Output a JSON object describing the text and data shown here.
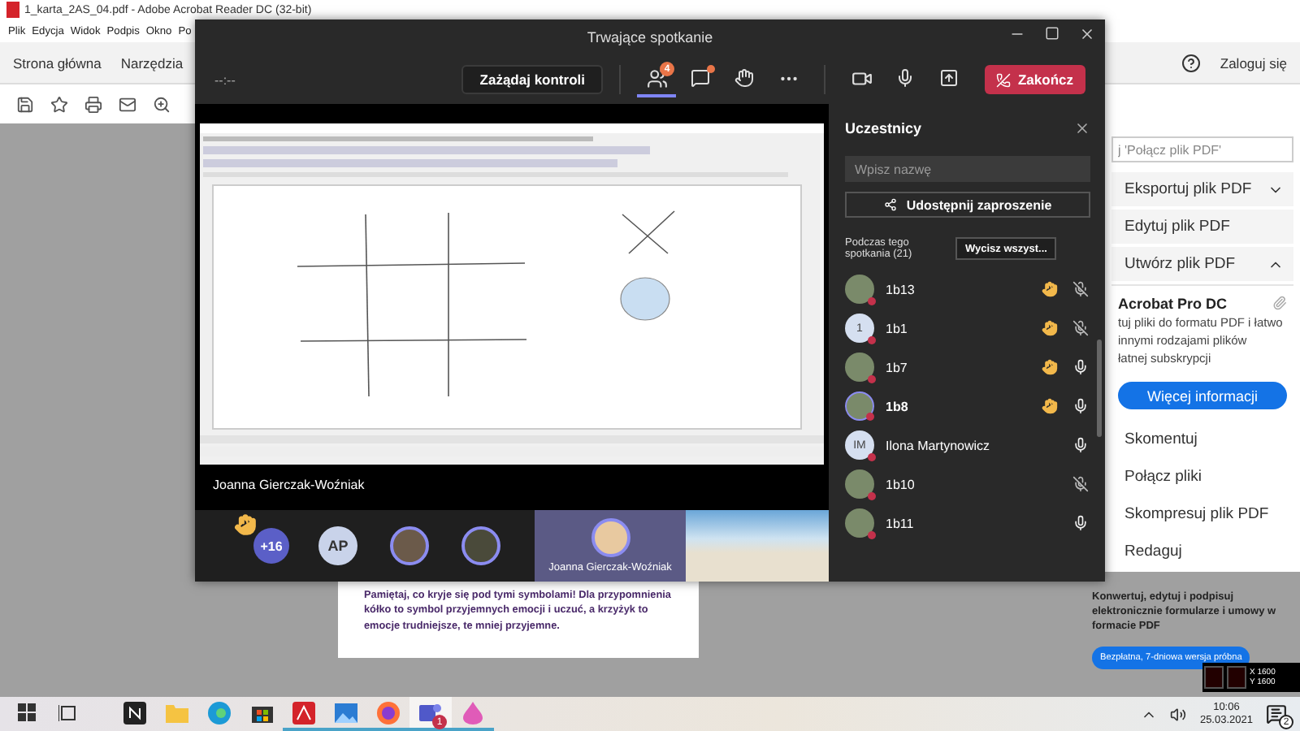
{
  "acrobat": {
    "title": "1_karta_2AS_04.pdf - Adobe Acrobat Reader DC (32-bit)",
    "menu": [
      "Plik",
      "Edycja",
      "Widok",
      "Podpis",
      "Okno",
      "Po"
    ],
    "tabs": [
      "Strona główna",
      "Narzędzia"
    ],
    "sign_in": "Zaloguj się",
    "tools_search": {
      "placeholder": "j 'Połącz plik PDF'"
    },
    "tools": [
      {
        "label": "Eksportuj plik PDF",
        "kind": "collapsible",
        "expanded": false
      },
      {
        "label": "Edytuj plik PDF",
        "kind": "plain"
      },
      {
        "label": "Utwórz plik PDF",
        "kind": "collapsible",
        "expanded": true
      }
    ],
    "promo": {
      "title": "Acrobat Pro DC",
      "lines": [
        "tuj pliki do formatu PDF i łatwo",
        "innymi rodzajami plików",
        "łatnej subskrypcji"
      ],
      "button": "Więcej informacji"
    },
    "more_tools": [
      "Skomentuj",
      "Połącz pliki",
      "Skompresuj plik PDF",
      "Redaguj"
    ],
    "offer": {
      "text": "Konwertuj, edytuj i podpisuj elektronicznie formularze i umowy w formacie PDF",
      "button": "Bezpłatna, 7-dniowa wersja próbna"
    },
    "document": {
      "text": "Pamiętaj, co kryje się pod tymi symbolami! Dla przypomnienia kółko to symbol przyjemnych emocji i uczuć, a krzyżyk to emocje trudniejsze, te mniej przyjemne."
    }
  },
  "teams": {
    "title": "Trwające spotkanie",
    "timer": "--:--",
    "request_control": "Zażądaj kontroli",
    "participants_badge": "4",
    "chat_unread": true,
    "end_call": "Zakończ",
    "presenter": "Joanna Gierczak-Woźniak",
    "panel": {
      "title": "Uczestnicy",
      "search": {
        "placeholder": "Wpisz nazwę"
      },
      "invite": "Udostępnij zaproszenie",
      "section": "Podczas tego spotkania (21)",
      "mute_all": "Wycisz wszyst...",
      "participants": [
        {
          "name": "1b13",
          "kind": "photo",
          "hand_raised": true,
          "muted": true,
          "speaking": false
        },
        {
          "name": "1b1",
          "kind": "initials",
          "initials": "1",
          "hand_raised": true,
          "muted": true,
          "speaking": false
        },
        {
          "name": "1b7",
          "kind": "photo",
          "hand_raised": true,
          "muted": false,
          "speaking": false
        },
        {
          "name": "1b8",
          "kind": "photo",
          "hand_raised": true,
          "muted": false,
          "speaking": true
        },
        {
          "name": "Ilona Martynowicz",
          "kind": "initials",
          "initials": "IM",
          "hand_raised": false,
          "muted": false,
          "speaking": false
        },
        {
          "name": "1b10",
          "kind": "photo",
          "hand_raised": false,
          "muted": true,
          "speaking": false
        },
        {
          "name": "1b11",
          "kind": "photo",
          "hand_raised": false,
          "muted": false,
          "speaking": false
        }
      ]
    },
    "strip": {
      "more": "+16",
      "initials": "AP",
      "tile_name": "Joanna Gierczak-Woźniak"
    }
  },
  "overlay": {
    "x": "X 1600",
    "y": "Y 1600"
  },
  "taskbar": {
    "apps": [
      {
        "kind": "taskview",
        "running": false
      },
      {
        "kind": "notes",
        "running": false
      },
      {
        "kind": "folder",
        "running": false
      },
      {
        "kind": "browser",
        "running": false
      },
      {
        "kind": "store",
        "running": false
      },
      {
        "kind": "pdf",
        "running": true
      },
      {
        "kind": "photos",
        "running": true
      },
      {
        "kind": "firefox",
        "running": true
      },
      {
        "kind": "teams",
        "running": true,
        "badge": "1"
      },
      {
        "kind": "paint",
        "running": true
      }
    ],
    "time": "10:06",
    "date": "25.03.2021",
    "notifications": "2"
  }
}
